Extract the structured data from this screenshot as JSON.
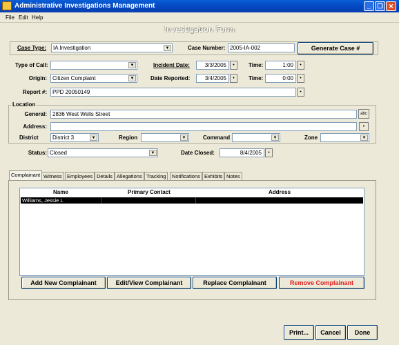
{
  "window": {
    "title": "Administrative Investigations Management"
  },
  "menu": [
    "File",
    "Edit",
    "Help"
  ],
  "form_title": "Investigation Form",
  "case": {
    "type_label": "Case Type:",
    "type_value": "IA Investigation",
    "number_label": "Case Number:",
    "number_value": "2005-IA-002",
    "generate_button": "Generate Case #"
  },
  "call": {
    "type_label": "Type of Call:",
    "type_value": "",
    "incident_date_label": "Incident Date:",
    "incident_date_value": "3/3/2005",
    "time1_label": "Time:",
    "time1_value": "1:00",
    "origin_label": "Origin:",
    "origin_value": "Citizen Complaint",
    "date_reported_label": "Date Reported:",
    "date_reported_value": "3/4/2005",
    "time2_label": "Time:",
    "time2_value": "0:00",
    "report_label": "Report #:",
    "report_value": "PPD 20050149"
  },
  "location": {
    "group_label": "Location",
    "general_label": "General:",
    "general_value": "2836 West Wells Street",
    "address_label": "Address:",
    "address_value": "",
    "district_label": "District",
    "district_value": "District 3",
    "region_label": "Region",
    "region_value": "",
    "command_label": "Command",
    "command_value": "",
    "zone_label": "Zone",
    "zone_value": ""
  },
  "status": {
    "status_label": "Status:",
    "status_value": "Closed",
    "date_closed_label": "Date Closed:",
    "date_closed_value": "8/4/2005"
  },
  "tabs": [
    "Complainant",
    "Witness",
    "Employees",
    "Details",
    "Allegations",
    "Tracking",
    "Notifications",
    "Exhibits",
    "Notes"
  ],
  "complainant_grid": {
    "columns": [
      "Name",
      "Primary Contact",
      "Address"
    ],
    "rows": [
      {
        "name": "Williams, Jessie L",
        "contact": "",
        "address": ""
      }
    ]
  },
  "complainant_buttons": {
    "add": "Add New Complainant",
    "edit": "Edit/View Complainant",
    "replace": "Replace Complainant",
    "remove": "Remove Complainant"
  },
  "footer_buttons": {
    "print": "Print...",
    "cancel": "Cancel",
    "done": "Done"
  },
  "colors": {
    "titlebar": "#0348c4",
    "remove_text": "#e02020",
    "selected_row": "#000000"
  }
}
